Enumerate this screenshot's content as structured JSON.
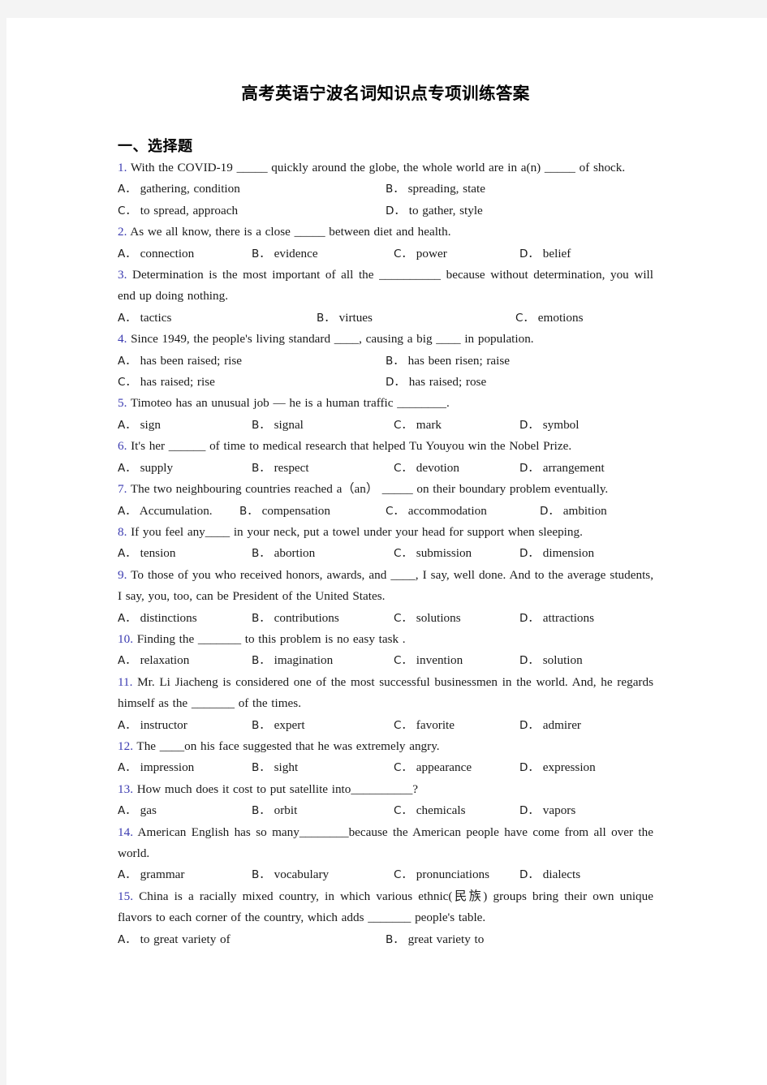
{
  "document": {
    "title": "高考英语宁波名词知识点专项训练答案",
    "section_heading": "一、选择题"
  },
  "colors": {
    "question_number": "#3b3bb0",
    "body_text": "#1a1a1a",
    "page_background": "#ffffff",
    "scan_edge": "#f4f4f4"
  },
  "questions": [
    {
      "num": "1.",
      "text": "With the COVID-19 _____ quickly around the globe, the whole world are in a(n) _____ of shock.",
      "layout": "cols-2",
      "options": [
        {
          "letter": "A．",
          "text": "gathering, condition"
        },
        {
          "letter": "B．",
          "text": "spreading, state"
        },
        {
          "letter": "C．",
          "text": "to spread, approach"
        },
        {
          "letter": "D．",
          "text": "to gather, style"
        }
      ],
      "option_rows": 2
    },
    {
      "num": "2.",
      "text": "As we all know, there is a close _____ between diet and health.",
      "layout": "cols-4",
      "options": [
        {
          "letter": "A．",
          "text": "connection"
        },
        {
          "letter": "B．",
          "text": "evidence"
        },
        {
          "letter": "C．",
          "text": "power"
        },
        {
          "letter": "D．",
          "text": "belief"
        }
      ],
      "option_rows": 1
    },
    {
      "num": "3.",
      "text": "Determination is the most important of all the __________ because without determination, you will end up doing nothing.",
      "layout": "cols-3",
      "options": [
        {
          "letter": "A．",
          "text": "tactics"
        },
        {
          "letter": "B．",
          "text": "virtues"
        },
        {
          "letter": "C．",
          "text": "emotions"
        }
      ],
      "option_rows": 1
    },
    {
      "num": "4.",
      "text": "Since 1949, the people's living standard ____, causing a big ____ in population.",
      "layout": "cols-2",
      "options": [
        {
          "letter": "A．",
          "text": "has been raised; rise"
        },
        {
          "letter": "B．",
          "text": "has been risen; raise"
        },
        {
          "letter": "C．",
          "text": "has raised; rise"
        },
        {
          "letter": "D．",
          "text": "has raised; rose"
        }
      ],
      "option_rows": 2
    },
    {
      "num": "5.",
      "text": "Timoteo has an unusual job — he is a human traffic ________.",
      "layout": "cols-4",
      "options": [
        {
          "letter": "A．",
          "text": "sign"
        },
        {
          "letter": "B．",
          "text": "signal"
        },
        {
          "letter": "C．",
          "text": "mark"
        },
        {
          "letter": "D．",
          "text": "symbol"
        }
      ],
      "option_rows": 1
    },
    {
      "num": "6.",
      "text": "It's her ______ of time to medical research that helped Tu Youyou win the Nobel Prize.",
      "layout": "cols-4",
      "options": [
        {
          "letter": "A．",
          "text": "supply"
        },
        {
          "letter": "B．",
          "text": "respect"
        },
        {
          "letter": "C．",
          "text": "devotion"
        },
        {
          "letter": "D．",
          "text": "arrangement"
        }
      ],
      "option_rows": 1
    },
    {
      "num": "7.",
      "text": "The two neighbouring countries reached a（an） _____ on their boundary problem eventually.",
      "layout": "cols-4b",
      "options": [
        {
          "letter": "A．",
          "text": "Accumulation."
        },
        {
          "letter": "B．",
          "text": "compensation"
        },
        {
          "letter": "C．",
          "text": "accommodation"
        },
        {
          "letter": "D．",
          "text": "ambition"
        }
      ],
      "option_rows": 1
    },
    {
      "num": "8.",
      "text": "If you feel any____ in your neck, put a towel under your head for support when sleeping.",
      "layout": "cols-4",
      "options": [
        {
          "letter": "A．",
          "text": "tension"
        },
        {
          "letter": "B．",
          "text": "abortion"
        },
        {
          "letter": "C．",
          "text": "submission"
        },
        {
          "letter": "D．",
          "text": "dimension"
        }
      ],
      "option_rows": 1
    },
    {
      "num": "9.",
      "text": "To those of you who received honors, awards, and ____, I say, well done. And to the average students, I say, you, too, can be President of the United States.",
      "layout": "cols-4",
      "options": [
        {
          "letter": "A．",
          "text": "distinctions"
        },
        {
          "letter": "B．",
          "text": "contributions"
        },
        {
          "letter": "C．",
          "text": "solutions"
        },
        {
          "letter": "D．",
          "text": "attractions"
        }
      ],
      "option_rows": 1
    },
    {
      "num": "10.",
      "text": "Finding the _______ to this problem is no easy task .",
      "layout": "cols-4",
      "options": [
        {
          "letter": "A．",
          "text": "relaxation"
        },
        {
          "letter": "B．",
          "text": "imagination"
        },
        {
          "letter": "C．",
          "text": "invention"
        },
        {
          "letter": "D．",
          "text": "solution"
        }
      ],
      "option_rows": 1
    },
    {
      "num": "11.",
      "text": "Mr. Li Jiacheng is considered one of the most successful businessmen in the world. And, he regards himself as the _______ of the times.",
      "layout": "cols-4",
      "options": [
        {
          "letter": "A．",
          "text": "instructor"
        },
        {
          "letter": "B．",
          "text": "expert"
        },
        {
          "letter": "C．",
          "text": "favorite"
        },
        {
          "letter": "D．",
          "text": "admirer"
        }
      ],
      "option_rows": 1
    },
    {
      "num": "12.",
      "text": "The ____on his face suggested that he was extremely angry.",
      "layout": "cols-4",
      "options": [
        {
          "letter": "A．",
          "text": "impression"
        },
        {
          "letter": "B．",
          "text": "sight"
        },
        {
          "letter": "C．",
          "text": "appearance"
        },
        {
          "letter": "D．",
          "text": "expression"
        }
      ],
      "option_rows": 1
    },
    {
      "num": "13.",
      "text": "How much does it cost to put satellite into__________?",
      "layout": "cols-4",
      "options": [
        {
          "letter": "A．",
          "text": "gas"
        },
        {
          "letter": "B．",
          "text": "orbit"
        },
        {
          "letter": "C．",
          "text": "chemicals"
        },
        {
          "letter": "D．",
          "text": "vapors"
        }
      ],
      "option_rows": 1
    },
    {
      "num": "14.",
      "text": "American English has so many________because the American people have come from all over the world.",
      "layout": "cols-4",
      "options": [
        {
          "letter": "A．",
          "text": "grammar"
        },
        {
          "letter": "B．",
          "text": "vocabulary"
        },
        {
          "letter": "C．",
          "text": "pronunciations"
        },
        {
          "letter": "D．",
          "text": "dialects"
        }
      ],
      "option_rows": 1
    },
    {
      "num": "15.",
      "text": "China is a racially mixed country, in which various ethnic(民族) groups bring their own unique flavors to each corner of the country, which adds _______ people's table.",
      "layout": "cols-2",
      "options": [
        {
          "letter": "A．",
          "text": "to great variety of"
        },
        {
          "letter": "B．",
          "text": "great variety to"
        }
      ],
      "option_rows": 1
    }
  ]
}
